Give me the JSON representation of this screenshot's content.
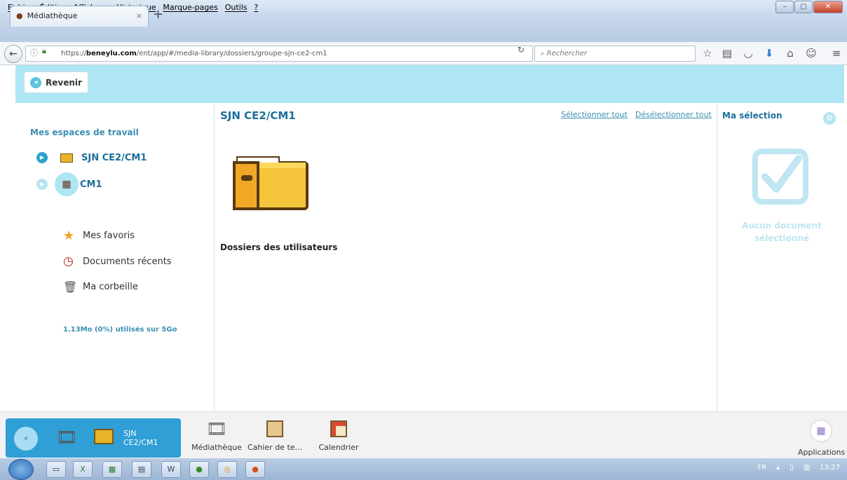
{
  "menubar": {
    "items": [
      "Fichier",
      "Édition",
      "Affichage",
      "Historique",
      "Marque-pages",
      "Outils",
      "?"
    ]
  },
  "browser": {
    "tab_title": "Médiathèque",
    "tab_close": "×",
    "new_tab": "+",
    "url_prefix": "https://",
    "url_host": "beneylu.com",
    "url_path": "/ent/app/#/media-library/dossiers/groupe-sjn-ce2-cm1",
    "search_placeholder": "Rechercher"
  },
  "header": {
    "back_label": "Revenir"
  },
  "sidebar": {
    "title": "Mes espaces de travail",
    "workspaces": [
      {
        "label": "SJN CE2/CM1"
      },
      {
        "label": "CM1"
      }
    ],
    "links": [
      {
        "label": "Mes favoris",
        "icon": "star-icon"
      },
      {
        "label": "Documents récents",
        "icon": "clock-icon"
      },
      {
        "label": "Ma corbeille",
        "icon": "trash-icon"
      }
    ],
    "quota": "1.13Mo (0%) utilisés sur 5Go"
  },
  "main": {
    "title": "SJN CE2/CM1",
    "select_all": "Sélectionner tout",
    "deselect_all": "Désélectionner tout",
    "folder_caption": "Dossiers des utilisateurs"
  },
  "selection": {
    "title": "Ma sélection",
    "empty_text": "Aucun document sélectionné"
  },
  "dock": {
    "active_label": "SJN CE2/CM1",
    "apps": [
      {
        "label": "Médiathèque"
      },
      {
        "label": "Cahier de te..."
      },
      {
        "label": "Calendrier"
      }
    ],
    "applications_label": "Applications"
  },
  "taskbar": {
    "lang": "FR",
    "time": "13:27"
  },
  "colors": {
    "header_bg": "#aee6f4",
    "accent": "#1d6f9a",
    "dock_active": "#2f9fd6"
  }
}
